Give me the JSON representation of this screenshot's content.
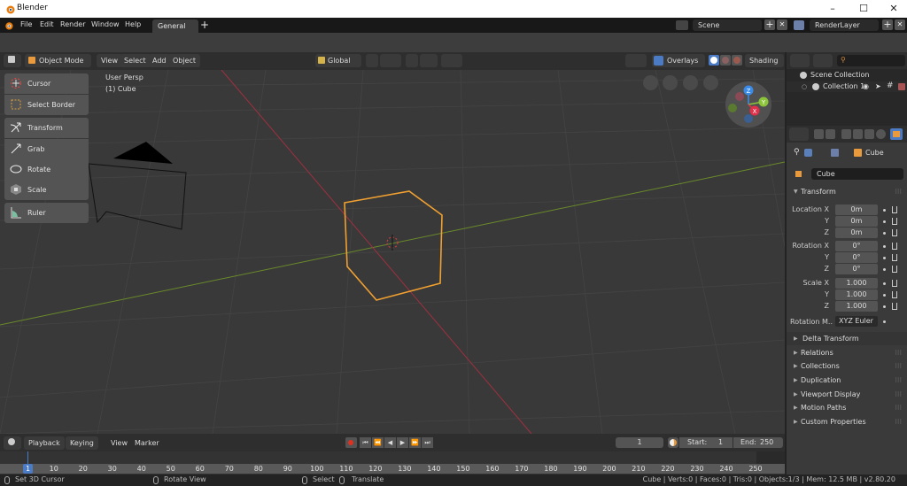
{
  "window": {
    "title": "Blender",
    "minimize_icon": "–",
    "maximize_icon": "☐",
    "close_icon": "✕"
  },
  "topbar": {
    "menus": [
      "File",
      "Edit",
      "Render",
      "Window",
      "Help"
    ],
    "workspace_tab": "General",
    "add_tab": "+",
    "scene": "Scene",
    "render_layer": "RenderLayer",
    "plus": "+",
    "x": "✕"
  },
  "viewport_header": {
    "mode": "Object Mode",
    "menus": [
      "View",
      "Select",
      "Add",
      "Object"
    ],
    "orientation": "Global",
    "overlays": "Overlays",
    "shading": "Shading"
  },
  "viewport": {
    "view_label": "User Persp",
    "object_label": "(1) Cube",
    "tools": [
      {
        "label": "Cursor",
        "icon": "cursor-icon"
      },
      {
        "label": "Select Border",
        "icon": "select-border-icon"
      },
      {
        "label": "Transform",
        "icon": "transform-icon"
      },
      {
        "label": "Grab",
        "icon": "grab-icon"
      },
      {
        "label": "Rotate",
        "icon": "rotate-icon"
      },
      {
        "label": "Scale",
        "icon": "scale-icon"
      },
      {
        "label": "Ruler",
        "icon": "ruler-icon"
      }
    ],
    "gizmo": {
      "z": "Z",
      "y": "Y",
      "x": "X"
    },
    "colors": {
      "selection": "#f0a030",
      "x_axis": "#b03040",
      "y_axis": "#6a8a2a"
    }
  },
  "outliner": {
    "items": [
      {
        "label": "Scene Collection"
      },
      {
        "label": "Collection 1"
      }
    ]
  },
  "properties": {
    "breadcrumb_object": "Cube",
    "object_name": "Cube",
    "transform_title": "Transform",
    "rows": [
      {
        "label": "Location X",
        "value": "0m"
      },
      {
        "label": "Y",
        "value": "0m"
      },
      {
        "label": "Z",
        "value": "0m"
      },
      {
        "label": "Rotation X",
        "value": "0°"
      },
      {
        "label": "Y",
        "value": "0°"
      },
      {
        "label": "Z",
        "value": "0°"
      },
      {
        "label": "Scale X",
        "value": "1.000"
      },
      {
        "label": "Y",
        "value": "1.000"
      },
      {
        "label": "Z",
        "value": "1.000"
      }
    ],
    "rotation_mode_label": "Rotation M..",
    "rotation_mode": "XYZ Euler",
    "panels": [
      "Delta Transform",
      "Relations",
      "Collections",
      "Duplication",
      "Viewport Display",
      "Motion Paths",
      "Custom Properties"
    ]
  },
  "timeline": {
    "menus": [
      "Playback",
      "Keying",
      "View",
      "Marker"
    ],
    "current_frame": "1",
    "start_label": "Start:",
    "start": "1",
    "end_label": "End:",
    "end": "250",
    "ruler_current": "1",
    "ticks": [
      "10",
      "20",
      "30",
      "40",
      "50",
      "60",
      "70",
      "80",
      "90",
      "100",
      "110",
      "120",
      "130",
      "140",
      "150",
      "160",
      "170",
      "180",
      "190",
      "200",
      "210",
      "220",
      "230",
      "240",
      "250"
    ]
  },
  "status": {
    "set_cursor": "Set 3D Cursor",
    "rotate_view": "Rotate View",
    "select": "Select",
    "translate": "Translate",
    "info": "Cube | Verts:0 | Faces:0 | Tris:0 | Objects:1/3 | Mem: 12.5 MB | v2.80.20"
  }
}
